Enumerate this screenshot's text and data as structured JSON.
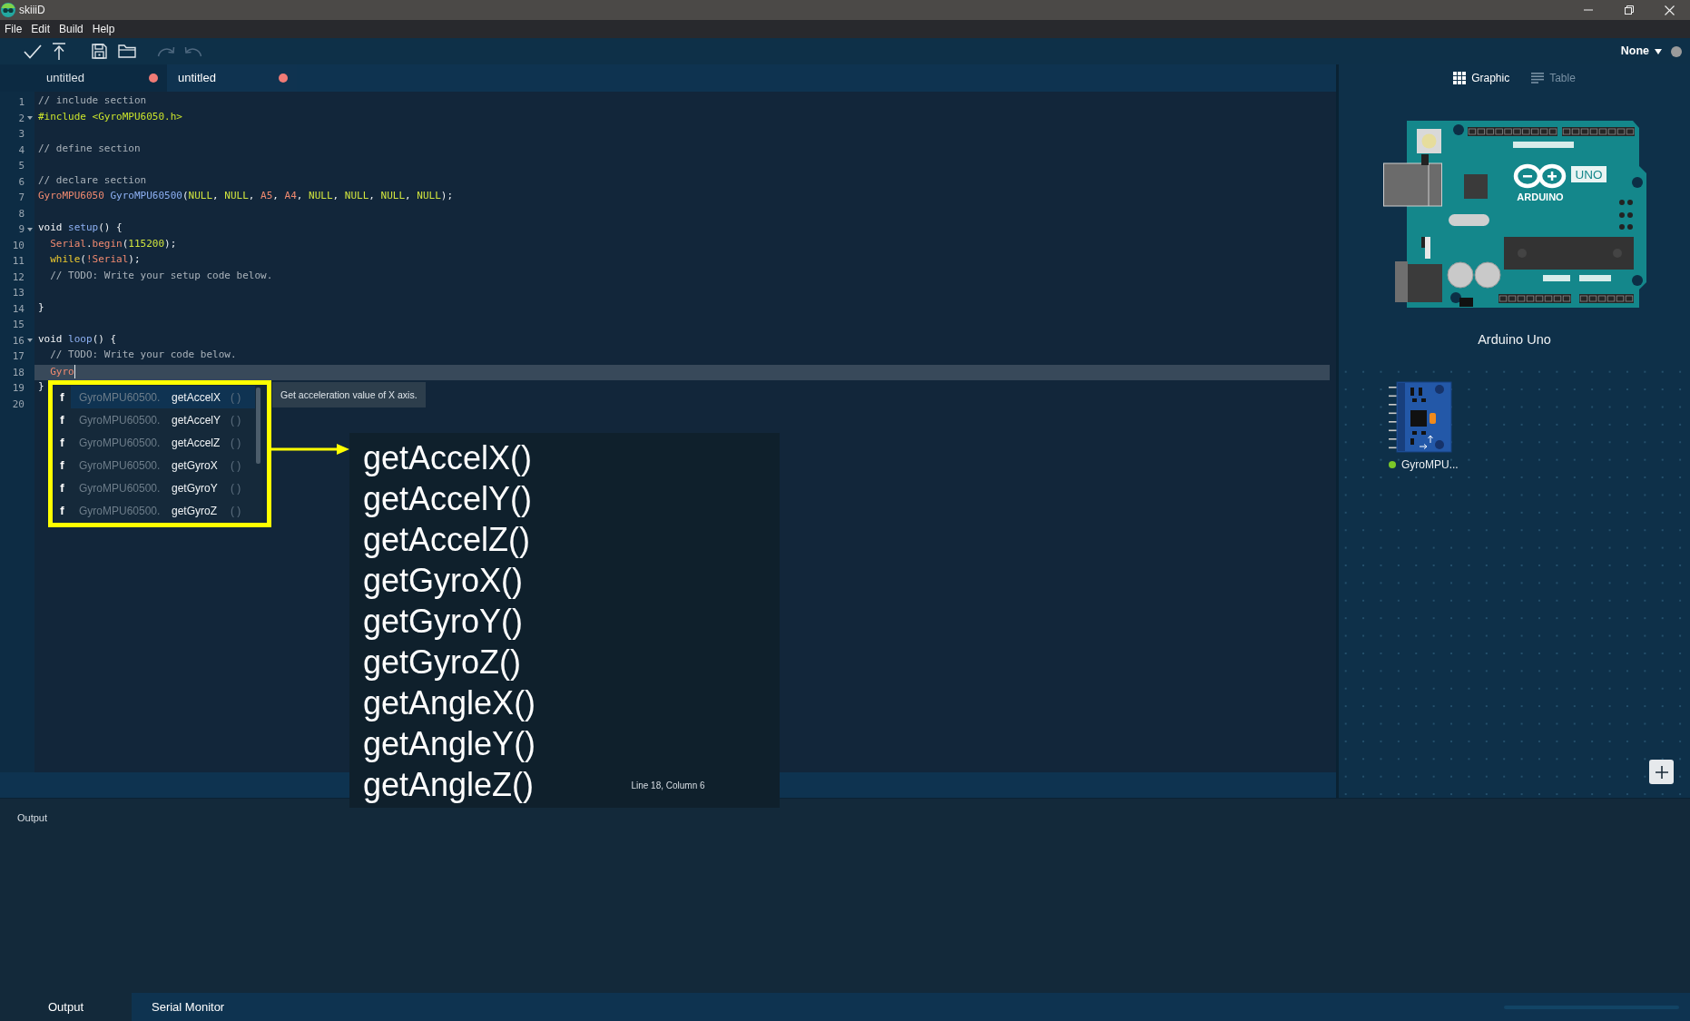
{
  "window": {
    "title": "skiiiD"
  },
  "menu": [
    "File",
    "Edit",
    "Build",
    "Help"
  ],
  "toolbar": {
    "buttons": [
      {
        "kind": "verify",
        "disabled": false
      },
      {
        "kind": "upload",
        "disabled": false
      },
      {
        "kind": "save",
        "disabled": false
      },
      {
        "kind": "open",
        "disabled": false
      },
      {
        "kind": "redo",
        "disabled": true
      },
      {
        "kind": "undo",
        "disabled": true
      }
    ],
    "port": "None",
    "port_connected": false
  },
  "tabs": [
    {
      "label": "untitled",
      "selected": false,
      "unsaved": true
    },
    {
      "label": "untitled",
      "selected": true,
      "unsaved": true
    }
  ],
  "editor": {
    "lines": [
      {
        "number": "1",
        "foldable": false,
        "current": false,
        "tokens": [
          {
            "kind": "comment",
            "text": "// include section"
          }
        ]
      },
      {
        "number": "2",
        "foldable": true,
        "current": false,
        "tokens": [
          {
            "kind": "directive",
            "text": "#include <GyroMPU6050.h>"
          }
        ]
      },
      {
        "number": "3",
        "foldable": false,
        "current": false
      },
      {
        "number": "4",
        "foldable": false,
        "current": false,
        "tokens": [
          {
            "kind": "comment",
            "text": "// define section"
          }
        ]
      },
      {
        "number": "5",
        "foldable": false,
        "current": false
      },
      {
        "number": "6",
        "foldable": false,
        "current": false,
        "tokens": [
          {
            "kind": "comment",
            "text": "// declare section"
          }
        ]
      },
      {
        "number": "7",
        "foldable": false,
        "current": false,
        "tokens": [
          {
            "kind": "object",
            "text": "GyroMPU6050"
          },
          {
            "kind": "name",
            "text": " GyroMPU60500"
          },
          {
            "kind": "plain",
            "text": "("
          },
          {
            "kind": "literal",
            "text": "NULL"
          },
          {
            "kind": "plain",
            "text": ", "
          },
          {
            "kind": "literal",
            "text": "NULL"
          },
          {
            "kind": "plain",
            "text": ", "
          },
          {
            "kind": "object",
            "text": "A5"
          },
          {
            "kind": "plain",
            "text": ", "
          },
          {
            "kind": "object",
            "text": "A4"
          },
          {
            "kind": "plain",
            "text": ", "
          },
          {
            "kind": "literal",
            "text": "NULL"
          },
          {
            "kind": "plain",
            "text": ", "
          },
          {
            "kind": "literal",
            "text": "NULL"
          },
          {
            "kind": "plain",
            "text": ", "
          },
          {
            "kind": "literal",
            "text": "NULL"
          },
          {
            "kind": "plain",
            "text": ", "
          },
          {
            "kind": "literal",
            "text": "NULL"
          },
          {
            "kind": "plain",
            "text": ");"
          }
        ]
      },
      {
        "number": "8",
        "foldable": false,
        "current": false
      },
      {
        "number": "9",
        "foldable": true,
        "current": false,
        "tokens": [
          {
            "kind": "keyword",
            "text": "void"
          },
          {
            "kind": "name",
            "text": " setup"
          },
          {
            "kind": "plain",
            "text": "() {"
          }
        ]
      },
      {
        "number": "10",
        "foldable": false,
        "current": false,
        "tokens": [
          {
            "kind": "object",
            "text": "  Serial"
          },
          {
            "kind": "plain",
            "text": "."
          },
          {
            "kind": "object",
            "text": "begin"
          },
          {
            "kind": "plain",
            "text": "("
          },
          {
            "kind": "literal",
            "text": "115200"
          },
          {
            "kind": "plain",
            "text": ");"
          }
        ]
      },
      {
        "number": "11",
        "foldable": false,
        "current": false,
        "tokens": [
          {
            "kind": "control",
            "text": "  while"
          },
          {
            "kind": "plain",
            "text": "("
          },
          {
            "kind": "object",
            "text": "!Serial"
          },
          {
            "kind": "plain",
            "text": ");"
          }
        ]
      },
      {
        "number": "12",
        "foldable": false,
        "current": false,
        "tokens": [
          {
            "kind": "comment",
            "text": "  // TODO: Write your setup code below."
          }
        ]
      },
      {
        "number": "13",
        "foldable": false,
        "current": false
      },
      {
        "number": "14",
        "foldable": false,
        "current": false,
        "tokens": [
          {
            "kind": "plain",
            "text": "}"
          }
        ]
      },
      {
        "number": "15",
        "foldable": false,
        "current": false
      },
      {
        "number": "16",
        "foldable": true,
        "current": false,
        "tokens": [
          {
            "kind": "keyword",
            "text": "void"
          },
          {
            "kind": "name",
            "text": " loop"
          },
          {
            "kind": "plain",
            "text": "() {"
          }
        ]
      },
      {
        "number": "17",
        "foldable": false,
        "current": false,
        "tokens": [
          {
            "kind": "comment",
            "text": "  // TODO: Write your code below."
          }
        ]
      },
      {
        "number": "18",
        "foldable": false,
        "current": true,
        "tokens": [
          {
            "kind": "object",
            "text": "  Gyro"
          }
        ]
      },
      {
        "number": "19",
        "foldable": false,
        "current": false,
        "tokens": [
          {
            "kind": "plain",
            "text": "}"
          }
        ]
      },
      {
        "number": "20",
        "foldable": false,
        "current": false
      }
    ]
  },
  "autocomplete": {
    "items": [
      {
        "symbol": "f",
        "owner": "GyroMPU60500.",
        "name": "getAccelX",
        "params": "( )",
        "selected": true
      },
      {
        "symbol": "f",
        "owner": "GyroMPU60500.",
        "name": "getAccelY",
        "params": "( )",
        "selected": false
      },
      {
        "symbol": "f",
        "owner": "GyroMPU60500.",
        "name": "getAccelZ",
        "params": "( )",
        "selected": false
      },
      {
        "symbol": "f",
        "owner": "GyroMPU60500.",
        "name": "getGyroX",
        "params": "( )",
        "selected": false
      },
      {
        "symbol": "f",
        "owner": "GyroMPU60500.",
        "name": "getGyroY",
        "params": "( )",
        "selected": false
      },
      {
        "symbol": "f",
        "owner": "GyroMPU60500.",
        "name": "getGyroZ",
        "params": "( )",
        "selected": false
      }
    ],
    "tooltip": "Get acceleration value of X axis."
  },
  "callout": {
    "functions": [
      "getAccelX()",
      "getAccelY()",
      "getAccelZ()",
      "getGyroX()",
      "getGyroY()",
      "getGyroZ()",
      "getAngleX()",
      "getAngleY()",
      "getAngleZ()"
    ]
  },
  "status_bar": {
    "position": "Line 18, Column 6"
  },
  "side_panel": {
    "views": [
      {
        "label": "Graphic",
        "kind": "grid",
        "selected": true
      },
      {
        "label": "Table",
        "kind": "list",
        "selected": false
      }
    ],
    "board": {
      "name": "Arduino Uno",
      "logo": "ARDUINO",
      "model": "UNO"
    },
    "modules": [
      {
        "name": "GyroMPU...",
        "color": "#7cc828"
      }
    ]
  },
  "output": {
    "title": "Output"
  },
  "bottom_tabs": [
    {
      "label": "Output",
      "selected": true
    },
    {
      "label": "Serial Monitor",
      "selected": false
    }
  ]
}
